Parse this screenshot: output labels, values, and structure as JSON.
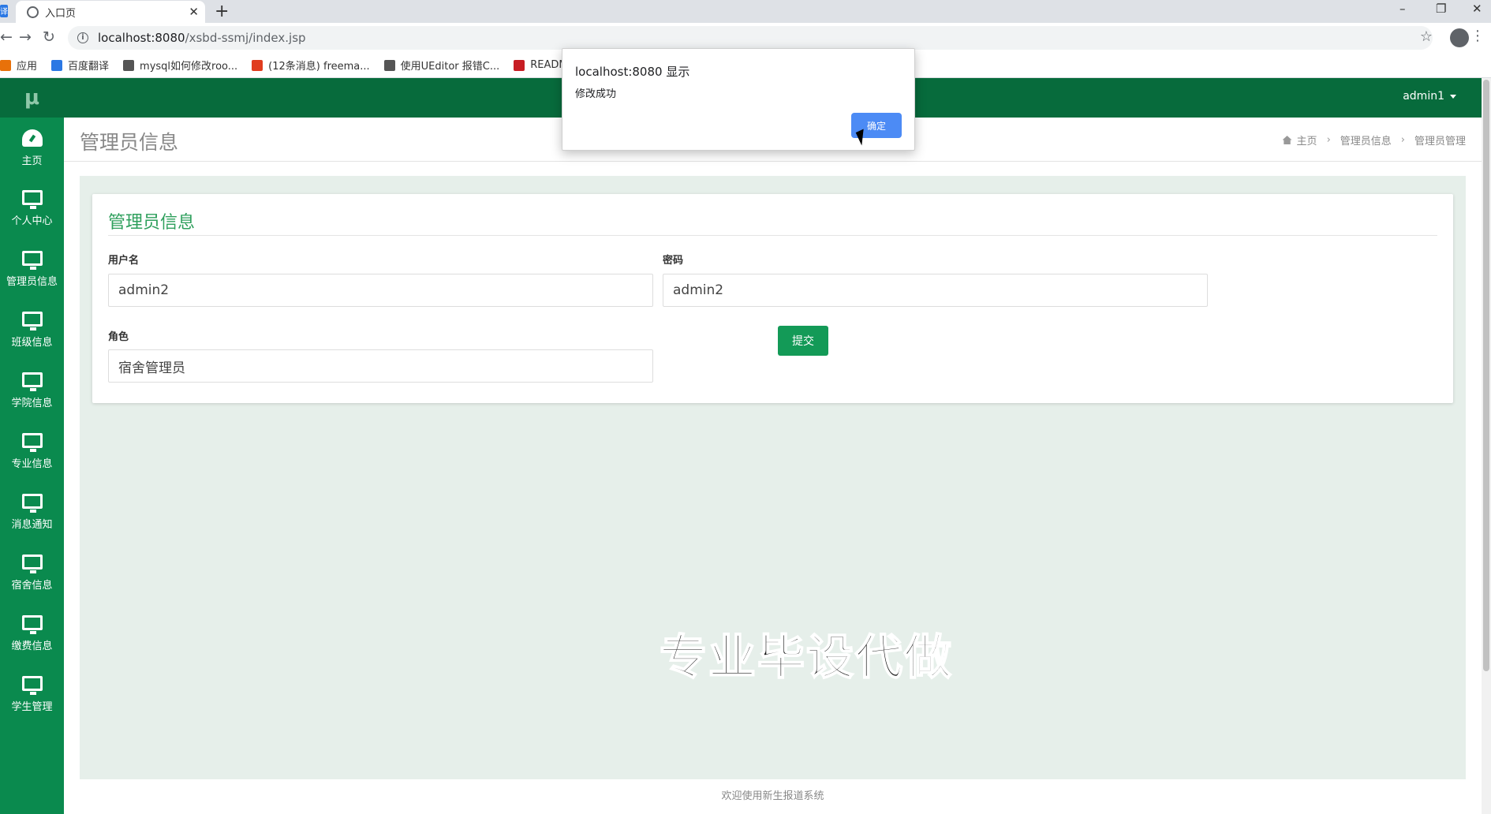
{
  "browser": {
    "tab_title": "入口页",
    "side_tab_mark": "译",
    "new_tab": "+",
    "url_host": "localhost:8080",
    "url_path": "/xsbd-ssmj/index.jsp",
    "window_controls": [
      "–",
      "❐",
      "✕"
    ],
    "bookmarks": [
      {
        "label": "应用",
        "icon": "apps-icon",
        "color": "#e8710a"
      },
      {
        "label": "百度翻译",
        "icon": "baidu-fanyi-icon",
        "color": "#2b78e4"
      },
      {
        "label": "mysql如何修改roo...",
        "icon": "link-icon",
        "color": "#555555"
      },
      {
        "label": "(12条消息) freema...",
        "icon": "csdn-icon",
        "color": "#e03c1e"
      },
      {
        "label": "使用UEditor 报错C...",
        "icon": "link-icon",
        "color": "#555555"
      },
      {
        "label": "README.md · ...",
        "icon": "gitee-icon",
        "color": "#c71d23"
      }
    ]
  },
  "app": {
    "logo": "μ",
    "sidebar": {
      "items": [
        {
          "label": "主页",
          "icon": "dashboard-icon"
        },
        {
          "label": "个人中心",
          "icon": "monitor-icon"
        },
        {
          "label": "管理员信息",
          "icon": "monitor-icon"
        },
        {
          "label": "班级信息",
          "icon": "monitor-icon"
        },
        {
          "label": "学院信息",
          "icon": "monitor-icon"
        },
        {
          "label": "专业信息",
          "icon": "monitor-icon"
        },
        {
          "label": "消息通知",
          "icon": "monitor-icon"
        },
        {
          "label": "宿舍信息",
          "icon": "monitor-icon"
        },
        {
          "label": "缴费信息",
          "icon": "monitor-icon"
        },
        {
          "label": "学生管理",
          "icon": "monitor-icon"
        }
      ]
    },
    "user_menu": "admin1",
    "page_title": "管理员信息",
    "breadcrumb": [
      "主页",
      "管理员信息",
      "管理员管理"
    ],
    "form": {
      "title": "管理员信息",
      "username_label": "用户名",
      "username_value": "admin2",
      "password_label": "密码",
      "password_value": "admin2",
      "role_label": "角色",
      "role_value": "宿舍管理员",
      "submit_label": "提交"
    },
    "watermark": "专业毕设代做",
    "footer": "欢迎使用新生报道系统"
  },
  "alert": {
    "title": "localhost:8080 显示",
    "message": "修改成功",
    "ok_label": "确定"
  },
  "colors": {
    "sidebar": "#0a8a4e",
    "topnav": "#076b3c",
    "accent_text": "#2e9f5c",
    "submit": "#139a57",
    "content_bg": "#e6efea",
    "dialog_button": "#4c8bf5"
  }
}
